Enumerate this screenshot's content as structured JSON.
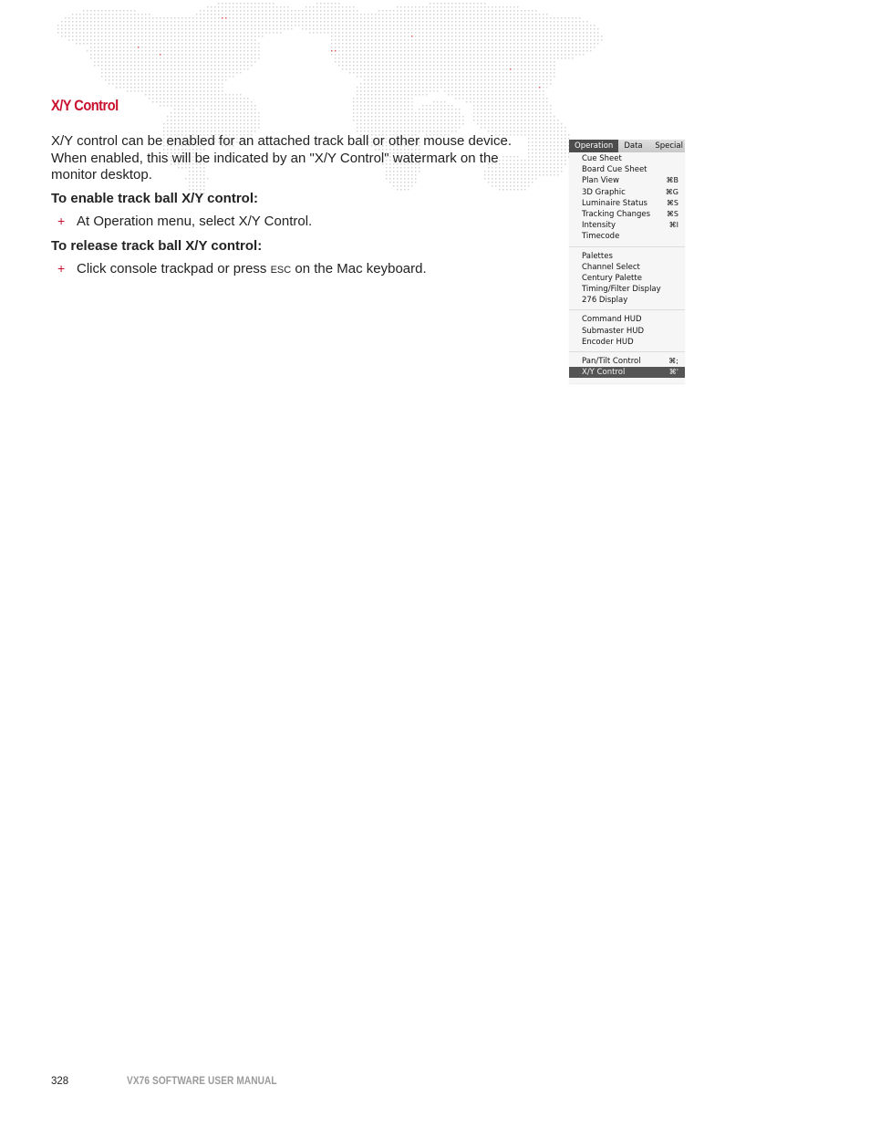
{
  "section": {
    "heading": "X/Y Control",
    "intro_lines": [
      "X/Y control can be enabled for an attached track ball or other mouse device.",
      "When enabled, this will be indicated by an \"X/Y Control\" watermark on the",
      "monitor desktop."
    ]
  },
  "procedures": [
    {
      "title": "To enable track ball X/Y control:",
      "step": {
        "bullet": "+",
        "parts": [
          "At ",
          "Operation",
          " menu, select ",
          "X/Y Control",
          "."
        ]
      }
    },
    {
      "title": "To release track ball X/Y control:",
      "step": {
        "bullet": "+",
        "parts": [
          "Click console trackpad or press ",
          "ESC",
          " on the Mac keyboard."
        ]
      }
    }
  ],
  "menu": {
    "tabs": [
      "Operation",
      "Data",
      "Special"
    ],
    "active_tab": "Operation",
    "groups": [
      [
        {
          "label": "Cue Sheet",
          "shortcut": ""
        },
        {
          "label": "Board Cue Sheet",
          "shortcut": ""
        },
        {
          "label": "Plan View",
          "shortcut": "⌘B"
        },
        {
          "label": "3D Graphic",
          "shortcut": "⌘G"
        },
        {
          "label": "Luminaire Status",
          "shortcut": "⌘S"
        },
        {
          "label": "Tracking Changes",
          "shortcut": "⌘S"
        },
        {
          "label": "Intensity",
          "shortcut": "⌘I"
        },
        {
          "label": "Timecode",
          "shortcut": ""
        }
      ],
      [
        {
          "label": "Palettes",
          "shortcut": ""
        },
        {
          "label": "Channel Select",
          "shortcut": ""
        },
        {
          "label": "Century Palette",
          "shortcut": ""
        },
        {
          "label": "Timing/Filter Display",
          "shortcut": ""
        },
        {
          "label": "276 Display",
          "shortcut": ""
        }
      ],
      [
        {
          "label": "Command HUD",
          "shortcut": ""
        },
        {
          "label": "Submaster HUD",
          "shortcut": ""
        },
        {
          "label": "Encoder HUD",
          "shortcut": ""
        }
      ],
      [
        {
          "label": "Pan/Tilt Control",
          "shortcut": "⌘;"
        },
        {
          "label": "X/Y Control",
          "shortcut": "⌘'",
          "selected": true
        }
      ]
    ]
  },
  "footer": {
    "page_number": "328",
    "manual_title": "VX76 SOFTWARE USER MANUAL"
  },
  "colors": {
    "accent": "#c8102e",
    "map_dots": "#d4d4d4",
    "map_highlight": "#e8504f",
    "menu_selected": "#555555"
  }
}
